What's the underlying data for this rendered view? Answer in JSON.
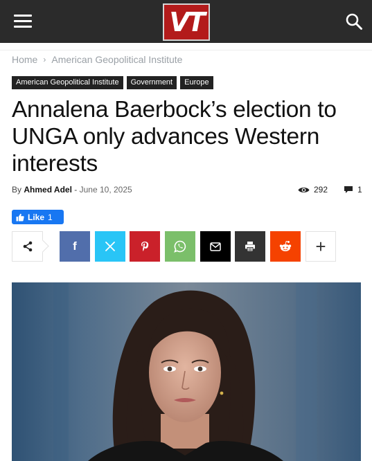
{
  "site": {
    "logo_text": "VT",
    "brand_color": "#b31b1b",
    "header_bg": "#2b2b2b"
  },
  "header": {
    "menu_icon": "hamburger-menu-icon",
    "search_icon": "search-icon"
  },
  "breadcrumb": {
    "home": "Home",
    "separator": "›",
    "current": "American Geopolitical Institute"
  },
  "tags": [
    "American Geopolitical Institute",
    "Government",
    "Europe"
  ],
  "article": {
    "title": "Annalena Baerbock’s election to UNGA only advances Western interests",
    "by_label": "By",
    "author": "Ahmed Adel",
    "date_separator": "-",
    "date": "June 10, 2025",
    "views": "292",
    "comments": "1"
  },
  "facebook": {
    "like_label": "Like",
    "like_count": "1",
    "color": "#1877f2"
  },
  "share_buttons": [
    {
      "name": "facebook",
      "glyph": "f",
      "color": "#516eab",
      "icon": "facebook-icon"
    },
    {
      "name": "x",
      "glyph": "𝕏",
      "color": "#29c5f6",
      "icon": "x-twitter-icon"
    },
    {
      "name": "pinterest",
      "glyph": "P",
      "color": "#ca212a",
      "icon": "pinterest-icon"
    },
    {
      "name": "whatsapp",
      "glyph": "",
      "color": "#7bbf6a",
      "icon": "whatsapp-icon"
    },
    {
      "name": "email",
      "glyph": "",
      "color": "#000000",
      "icon": "email-icon"
    },
    {
      "name": "print",
      "glyph": "",
      "color": "#333333",
      "icon": "print-icon"
    },
    {
      "name": "reddit",
      "glyph": "",
      "color": "#f54200",
      "icon": "reddit-icon"
    },
    {
      "name": "more",
      "glyph": "+",
      "color": "#ffffff",
      "icon": "plus-icon"
    }
  ]
}
